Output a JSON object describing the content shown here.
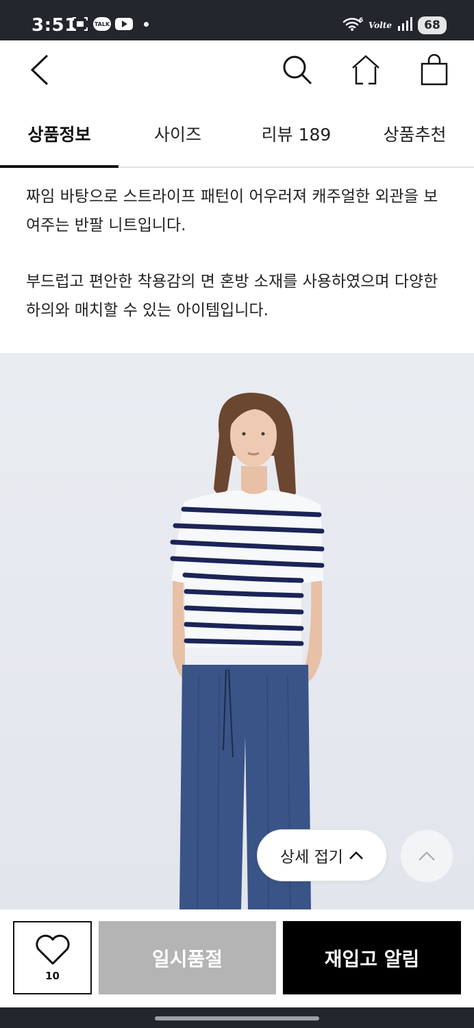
{
  "status_bar": {
    "time": "3:51",
    "talk_label": "TALK",
    "network_label": "Volte",
    "battery": "68"
  },
  "tabs": [
    {
      "label": "상품정보"
    },
    {
      "label": "사이즈"
    },
    {
      "label": "리뷰 189"
    },
    {
      "label": "상품추천"
    }
  ],
  "description": {
    "paragraph_1": "짜임 바탕으로 스트라이프 패턴이 어우러져 캐주얼한 외관을 보여주는 반팔 니트입니다.",
    "paragraph_2": "부드럽고 편안한 착용감의 면 혼방 소재를 사용하였으며 다양한 하의와 매치할 수 있는 아이템입니다."
  },
  "fold_button": {
    "label": "상세 접기"
  },
  "bottom_bar": {
    "wish_count": "10",
    "soldout_label": "일시품절",
    "restock_label": "재입고 알림"
  },
  "colors": {
    "status_bar_bg": "#23262d",
    "accent_black": "#000000",
    "disabled_gray": "#b4b4b4"
  },
  "icons": [
    "back-icon",
    "search-icon",
    "home-icon",
    "shopping-bag-icon",
    "heart-icon",
    "chevron-up-icon"
  ]
}
